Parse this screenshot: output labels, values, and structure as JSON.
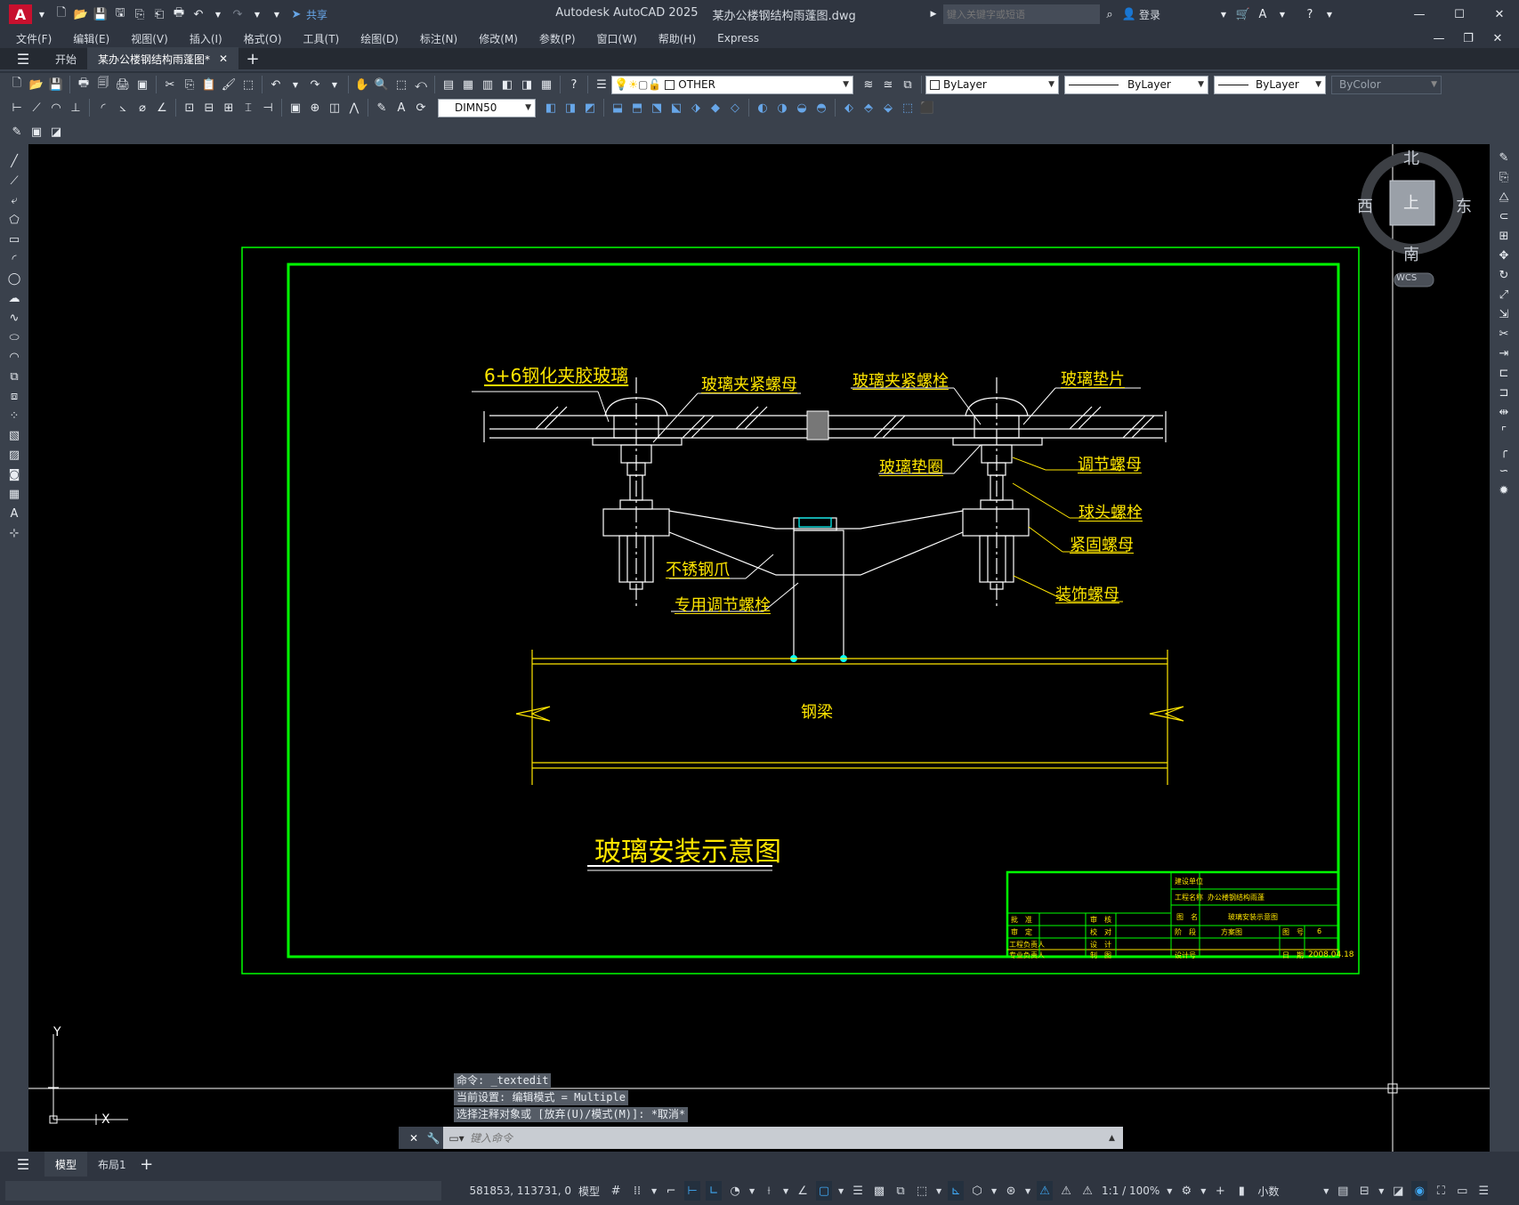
{
  "titlebar": {
    "app_title": "Autodesk AutoCAD 2025",
    "file_title": "某办公楼钢结构雨蓬图.dwg",
    "share_label": "共享",
    "search_placeholder": "键入关键字或短语",
    "login_label": "登录"
  },
  "menubar": {
    "items": [
      "文件(F)",
      "编辑(E)",
      "视图(V)",
      "插入(I)",
      "格式(O)",
      "工具(T)",
      "绘图(D)",
      "标注(N)",
      "修改(M)",
      "参数(P)",
      "窗口(W)",
      "帮助(H)",
      "Express"
    ]
  },
  "tabs": {
    "start_label": "开始",
    "doc_label": "某办公楼钢结构雨蓬图*"
  },
  "properties": {
    "layer": "OTHER",
    "color": "ByLayer",
    "linetype": "ByLayer",
    "lineweight": "ByLayer",
    "plotstyle": "ByColor",
    "dimstyle": "DIMN50"
  },
  "viewcube": {
    "north": "北",
    "south": "南",
    "east": "东",
    "west": "西",
    "face": "上",
    "wcs": "WCS"
  },
  "drawing": {
    "labels": {
      "glass": "6+6钢化夹胶玻璃",
      "clamp_nut": "玻璃夹紧螺母",
      "clamp_bolt": "玻璃夹紧螺栓",
      "glass_pad": "玻璃垫片",
      "glass_ring": "玻璃垫圈",
      "adjust_nut": "调节螺母",
      "ball_bolt": "球头螺栓",
      "fasten_nut": "紧固螺母",
      "claw": "不锈钢爪",
      "decor_nut": "装饰螺母",
      "adjust_bolt": "专用调节螺栓",
      "beam": "钢梁"
    },
    "title": "玻璃安装示意图",
    "title_block": {
      "unit": "建设单位",
      "project_label": "工程名称",
      "project_value": "办公楼钢结构雨蓬",
      "drawing_label": "图　名",
      "drawing_value": "玻璃安装示意图",
      "stage_label": "阶　段",
      "stage_value": "方案图",
      "number_label": "图　号",
      "number_value": "6",
      "date_label": "日　期",
      "date_value": "2008.04.18",
      "r1": "批　准",
      "r2": "审　定",
      "r3": "工程负责人",
      "r4": "专业负责人",
      "c1": "审　核",
      "c2": "校　对",
      "c3": "设　计",
      "c4": "制　图",
      "d4": "设计号"
    },
    "ucs_x": "X",
    "ucs_y": "Y"
  },
  "command": {
    "history": [
      "命令: _textedit",
      "当前设置: 编辑模式 = Multiple",
      "选择注释对象或 [放弃(U)/模式(M)]: *取消*"
    ],
    "placeholder": "键入命令"
  },
  "layout_tabs": {
    "model": "模型",
    "layout1": "布局1"
  },
  "status": {
    "coords": "581853, 113731, 0",
    "model": "模型",
    "scale": "1:1 / 100%",
    "units": "小数"
  }
}
